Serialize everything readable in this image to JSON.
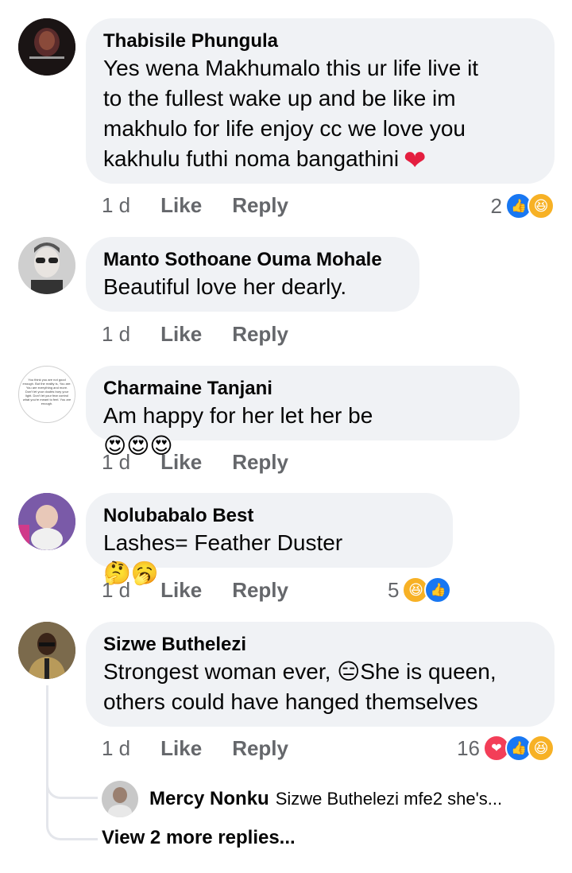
{
  "comments": [
    {
      "author": "Thabisile Phungula",
      "text": "Yes wena Makhumalo this ur life live it\nto the fullest wake up and be like im\nmakhulo for life enjoy cc we love you\nkakhulu futhi noma bangathini",
      "time": "1 d",
      "like": "Like",
      "reply": "Reply",
      "reaction_count": "2"
    },
    {
      "author": "Manto Sothoane Ouma Mohale",
      "text": "Beautiful love her dearly.",
      "time": "1 d",
      "like": "Like",
      "reply": "Reply"
    },
    {
      "author": "Charmaine Tanjani",
      "text": "Am happy for her let her be",
      "time": "1 d",
      "like": "Like",
      "reply": "Reply"
    },
    {
      "author": "Nolubabalo Best",
      "text": "Lashes= Feather Duster",
      "time": "1 d",
      "like": "Like",
      "reply": "Reply",
      "reaction_count": "5"
    },
    {
      "author": "Sizwe Buthelezi",
      "text_part1": "Strongest woman ever, ",
      "text_part2": "She is queen,",
      "text_line2": "others could have hanged themselves",
      "time": "1 d",
      "like": "Like",
      "reply": "Reply",
      "reaction_count": "16"
    }
  ],
  "reply_preview": {
    "author": "Mercy Nonku",
    "text": "Sizwe Buthelezi mfe2 she's..."
  },
  "view_more": "View 2 more replies...",
  "avatar3_text": "You think you are not good enough. But the reality is, You are: You are everything and more. Don't let your doubts bury your light. Don't let your fear control what you're meant to feel. You are enough.",
  "colors": {
    "bubble": "#f0f2f5",
    "secondary_text": "#65676b",
    "like_blue": "#1877f2",
    "love_red": "#f33e58",
    "haha_yellow": "#f7b125"
  }
}
